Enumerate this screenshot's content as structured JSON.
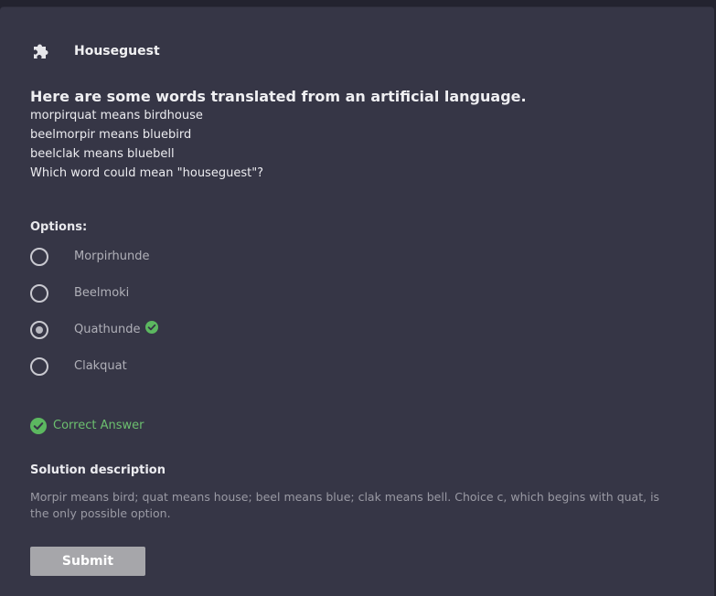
{
  "header": {
    "icon": "puzzle-icon",
    "title": "Houseguest"
  },
  "question": {
    "title": "Here are some words translated from an artificial language.",
    "lines": [
      "morpirquat means birdhouse",
      "beelmorpir means bluebird",
      "beelclak means bluebell",
      "Which word could mean \"houseguest\"?"
    ]
  },
  "options": {
    "label": "Options:",
    "items": [
      {
        "label": "Morpirhunde",
        "selected": false
      },
      {
        "label": "Beelmoki",
        "selected": false
      },
      {
        "label": "Quathunde",
        "selected": true,
        "correct": true
      },
      {
        "label": "Clakquat",
        "selected": false
      }
    ]
  },
  "result": {
    "text": "Correct Answer",
    "color": "#6cbf6f"
  },
  "solution": {
    "title": "Solution description",
    "text": "Morpir means bird; quat means house; beel means blue; clak means bell. Choice c, which begins with quat, is the only possible option."
  },
  "submit": {
    "label": "Submit"
  }
}
